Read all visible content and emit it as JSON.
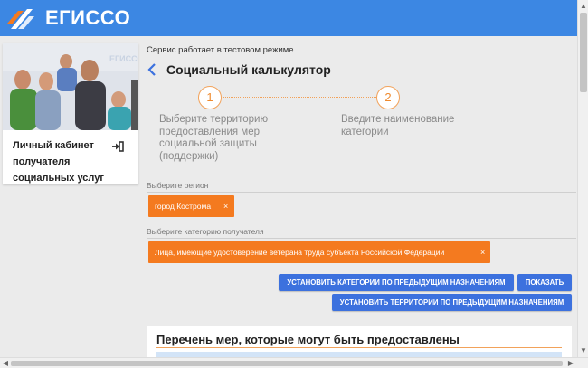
{
  "header": {
    "logo_text": "ЕГИССО",
    "color": "#3c87e3"
  },
  "sidebar": {
    "cabinet_label": "Личный кабинет получателя социальных услуг",
    "login_icon": "login-arrow-icon"
  },
  "main": {
    "notice": "Сервис работает в тестовом режиме",
    "title": "Социальный калькулятор",
    "steps": [
      {
        "number": "1",
        "text": "Выберите территорию предоставления мер социальной защиты (поддержки)"
      },
      {
        "number": "2",
        "text": "Введите наименование категории"
      }
    ],
    "region": {
      "label": "Выберите регион",
      "selected": "город Кострома",
      "remove": "×"
    },
    "category": {
      "label": "Выберите категорию получателя",
      "selected": "Лица, имеющие удостоверение ветерана труда субъекта Российской Федерации",
      "remove": "×"
    },
    "buttons": {
      "set_categories": "УСТАНОВИТЬ КАТЕГОРИИ ПО ПРЕДЫДУЩИМ НАЗНАЧЕНИЯМ",
      "show": "ПОКАЗАТЬ",
      "set_territories": "УСТАНОВИТЬ ТЕРРИТОРИИ ПО ПРЕДЫДУЩИМ НАЗНАЧЕНИЯМ"
    },
    "list_title": "Перечень мер, которые могут быть предоставлены"
  },
  "colors": {
    "accent_orange": "#f47a1f",
    "button_blue": "#3c71de"
  }
}
